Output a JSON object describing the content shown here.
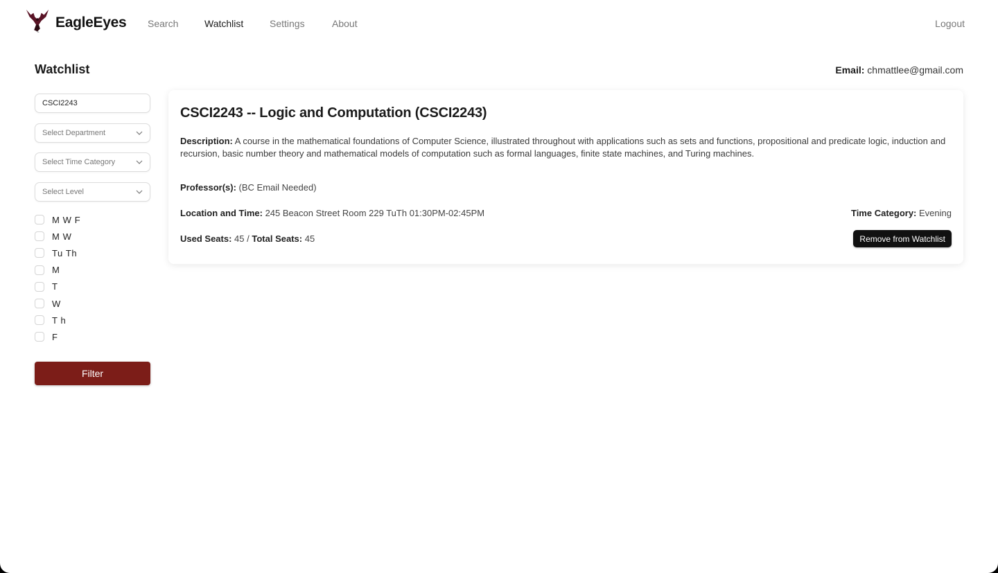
{
  "nav": {
    "brand": "EagleEyes",
    "links": [
      {
        "label": "Search",
        "active": false
      },
      {
        "label": "Watchlist",
        "active": true
      },
      {
        "label": "Settings",
        "active": false
      },
      {
        "label": "About",
        "active": false
      }
    ],
    "logout": "Logout",
    "logo_icon": "eagle-logo-icon",
    "brand_color": "#5a1426"
  },
  "header": {
    "title": "Watchlist",
    "email_label": "Email:",
    "email_value": "chmattlee@gmail.com"
  },
  "sidebar": {
    "search_value": "CSCI2243",
    "department_placeholder": "Select Department",
    "time_category_placeholder": "Select Time Category",
    "level_placeholder": "Select Level",
    "day_options": [
      {
        "label": "M W F",
        "checked": false
      },
      {
        "label": "M W",
        "checked": false
      },
      {
        "label": "Tu Th",
        "checked": false
      },
      {
        "label": "M",
        "checked": false
      },
      {
        "label": "T",
        "checked": false
      },
      {
        "label": "W",
        "checked": false
      },
      {
        "label": "T h",
        "checked": false
      },
      {
        "label": "F",
        "checked": false
      }
    ],
    "filter_label": "Filter",
    "filter_color": "#7c1d18"
  },
  "course": {
    "title": "CSCI2243 -- Logic and Computation (CSCI2243)",
    "description_label": "Description:",
    "description": "A course in the mathematical foundations of Computer Science, illustrated throughout with applications such as sets and functions, propositional and predicate logic, induction and recursion, basic number theory and mathematical models of computation such as formal languages, finite state machines, and Turing machines.",
    "professor_label": "Professor(s):",
    "professor": "(BC Email Needed)",
    "location_label": "Location and Time:",
    "location": "245 Beacon Street Room 229 TuTh 01:30PM-02:45PM",
    "time_category_label": "Time Category:",
    "time_category": "Evening",
    "used_seats_label": "Used Seats:",
    "used_seats": "45",
    "separator": "/",
    "total_seats_label": "Total Seats:",
    "total_seats": "45",
    "remove_label": "Remove from Watchlist"
  }
}
